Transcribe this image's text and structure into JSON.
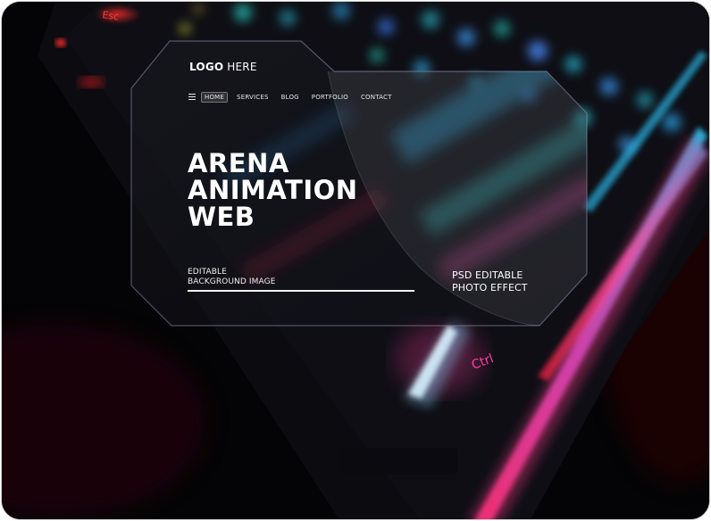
{
  "header": {
    "logo_bold": "LOGO",
    "logo_rest": " HERE"
  },
  "nav": {
    "items": [
      "HOME",
      "SERVICES",
      "BLOG",
      "PORTFOLIO",
      "CONTACT"
    ],
    "active": "HOME",
    "menu_icon": "hamburger-menu-icon"
  },
  "hero": {
    "line1": "ARENA",
    "line2": "ANIMATION",
    "line3": "WEB"
  },
  "caption_left": {
    "line1": "EDITABLE",
    "line2": "BACKGROUND IMAGE"
  },
  "caption_right": {
    "line1": "PSD EDITABLE",
    "line2": "PHOTO EFFECT"
  },
  "background": {
    "keycap_labels": [
      "Esc",
      "Ctrl"
    ]
  },
  "colors": {
    "background": "#050507",
    "text": "#ffffff",
    "rgb_cyan": "#2ec7e8",
    "rgb_pink": "#ff3a8c",
    "rgb_red": "#d81e2c"
  }
}
